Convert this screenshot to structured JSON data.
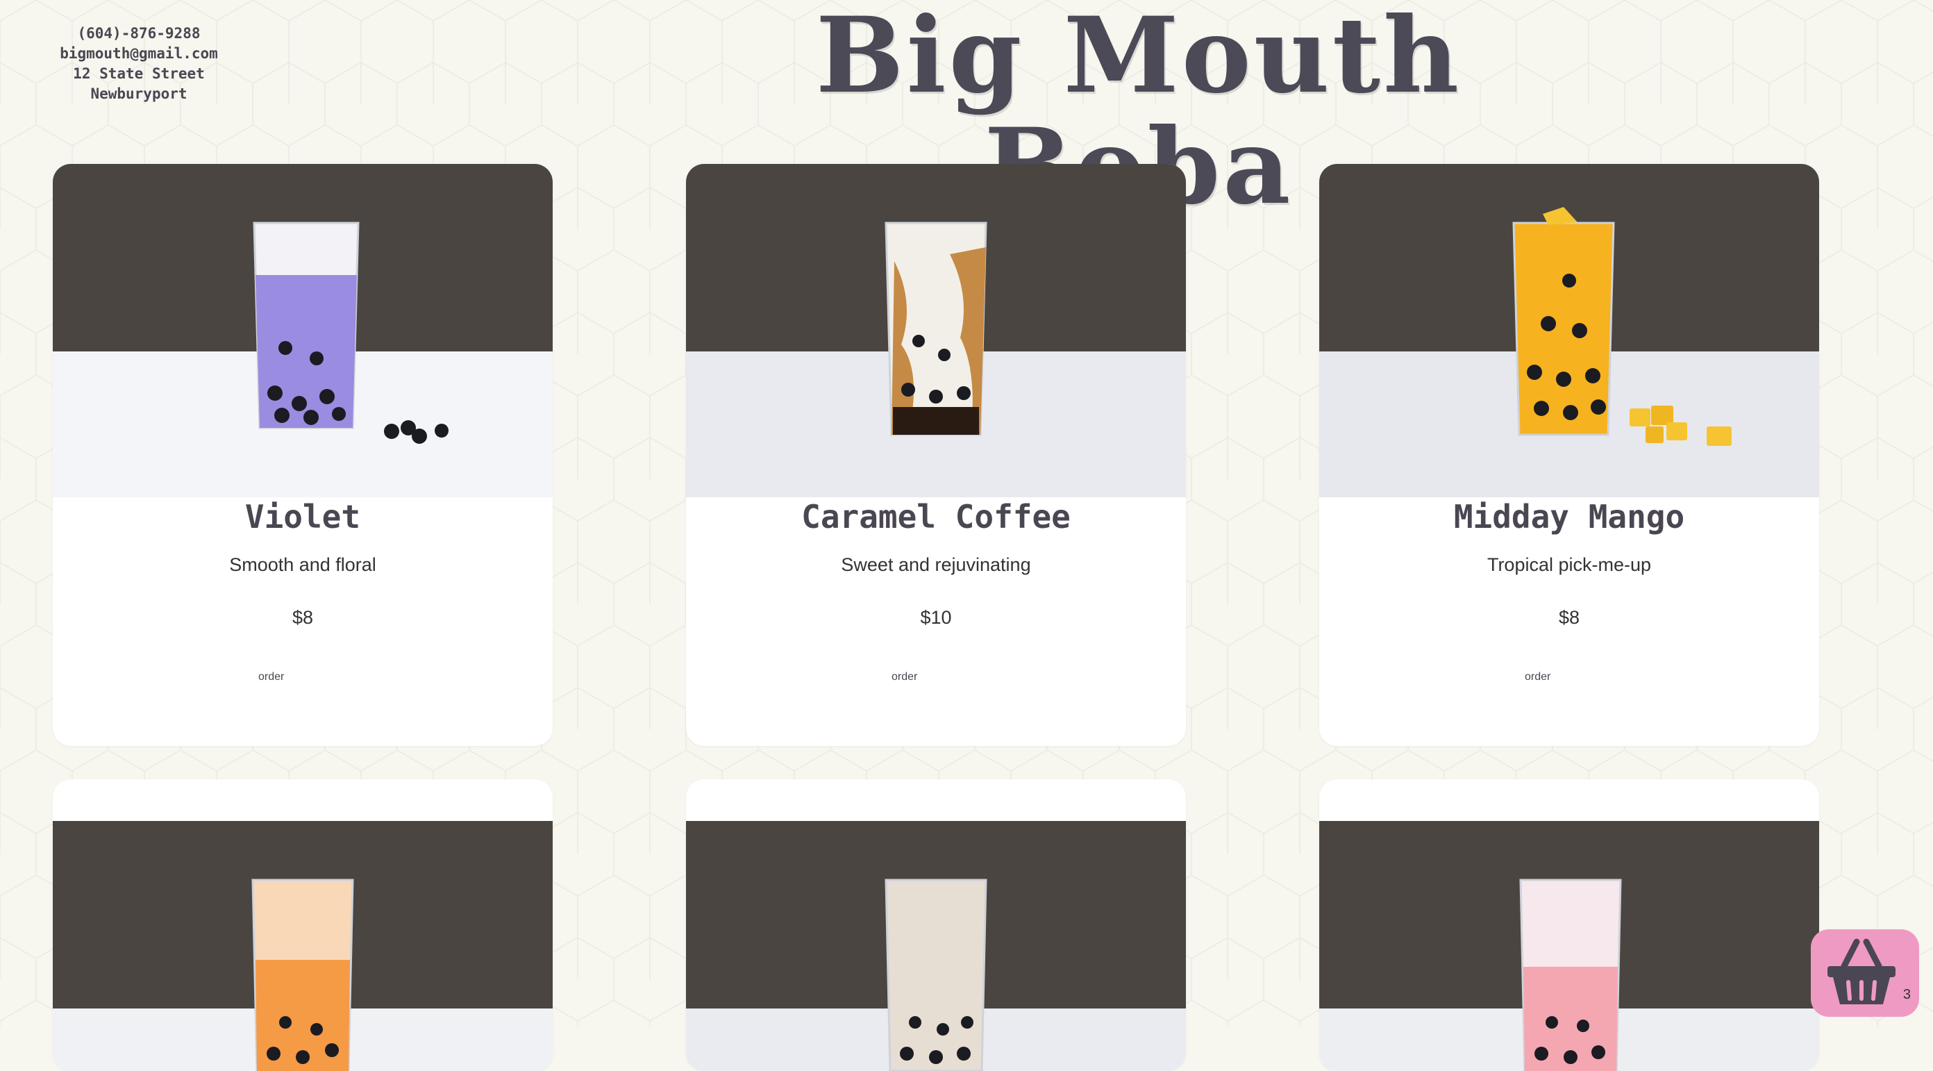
{
  "header": {
    "phone": "(604)-876-9288",
    "email": "bigmouth@gmail.com",
    "address": "12 State Street Newburyport",
    "brand": "Big Mouth Boba"
  },
  "menu": [
    {
      "name": "Violet",
      "description": "Smooth and floral",
      "price": "$8",
      "order_label": "order",
      "drink_color": "#9a8ce0",
      "topping": "tapioca-pearls"
    },
    {
      "name": "Caramel Coffee",
      "description": "Sweet and rejuvinating",
      "price": "$10",
      "order_label": "order",
      "drink_color": "#c58a46",
      "topping": "none"
    },
    {
      "name": "Midday Mango",
      "description": "Tropical pick-me-up",
      "price": "$8",
      "order_label": "order",
      "drink_color": "#f6b21f",
      "topping": "mango-cubes"
    },
    {
      "drink_color": "#f59a45"
    },
    {
      "drink_color": "#e6ddd3"
    },
    {
      "drink_color": "#f4a7b1"
    }
  ],
  "cart": {
    "icon": "basket-icon",
    "count": "3"
  },
  "colors": {
    "background": "#f7f6ef",
    "card": "#ffffff",
    "cart": "#ef9ac3",
    "text": "#4a4752"
  }
}
